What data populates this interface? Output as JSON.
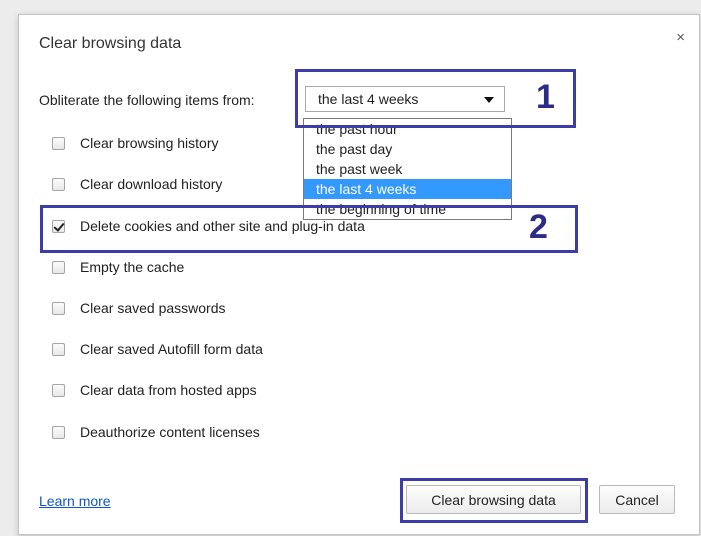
{
  "dialog": {
    "title": "Clear browsing data",
    "close_glyph": "×"
  },
  "range": {
    "label": "Obliterate the following items from:",
    "selected": "the last 4 weeks",
    "options": [
      "the past hour",
      "the past day",
      "the past week",
      "the last 4 weeks",
      "the beginning of time"
    ],
    "selected_index": 3
  },
  "items": [
    {
      "label": "Clear browsing history",
      "checked": false
    },
    {
      "label": "Clear download history",
      "checked": false
    },
    {
      "label": "Delete cookies and other site and plug-in data",
      "checked": true
    },
    {
      "label": "Empty the cache",
      "checked": false
    },
    {
      "label": "Clear saved passwords",
      "checked": false
    },
    {
      "label": "Clear saved Autofill form data",
      "checked": false
    },
    {
      "label": "Clear data from hosted apps",
      "checked": false
    },
    {
      "label": "Deauthorize content licenses",
      "checked": false
    }
  ],
  "footer": {
    "learn_more": "Learn more",
    "clear_button": "Clear browsing data",
    "cancel_button": "Cancel"
  },
  "annotations": {
    "one": "1",
    "two": "2",
    "color": "#3d3da8"
  }
}
